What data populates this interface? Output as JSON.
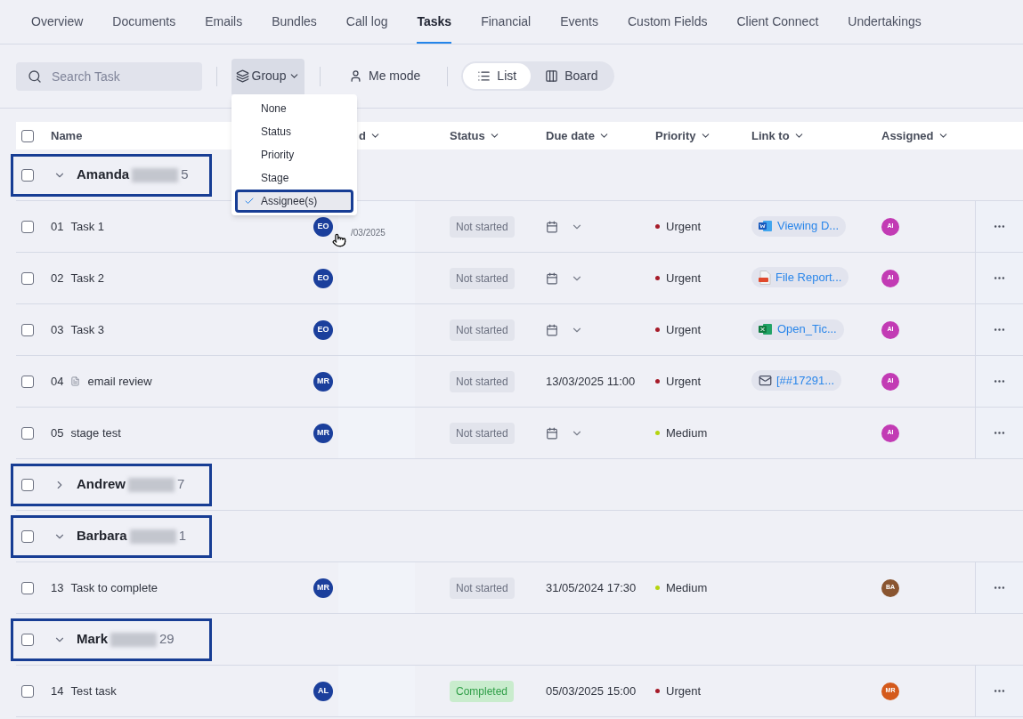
{
  "tabs": [
    {
      "label": "Overview",
      "selected": false
    },
    {
      "label": "Documents",
      "selected": false
    },
    {
      "label": "Emails",
      "selected": false
    },
    {
      "label": "Bundles",
      "selected": false
    },
    {
      "label": "Call log",
      "selected": false
    },
    {
      "label": "Tasks",
      "selected": true
    },
    {
      "label": "Financial",
      "selected": false
    },
    {
      "label": "Events",
      "selected": false
    },
    {
      "label": "Custom Fields",
      "selected": false
    },
    {
      "label": "Client Connect",
      "selected": false
    },
    {
      "label": "Undertakings",
      "selected": false
    }
  ],
  "toolbar": {
    "search": {
      "placeholder": "Search Task"
    },
    "group_button": "Group",
    "me_mode": "Me mode",
    "views": [
      {
        "label": "List",
        "kind": "list",
        "selected": true
      },
      {
        "label": "Board",
        "kind": "board",
        "selected": false
      }
    ]
  },
  "group_menu": [
    {
      "label": "None",
      "selected": false
    },
    {
      "label": "Status",
      "selected": false
    },
    {
      "label": "Priority",
      "selected": false
    },
    {
      "label": "Stage",
      "selected": false
    },
    {
      "label": "Assignee(s)",
      "selected": true
    }
  ],
  "select_all": {
    "checked": false
  },
  "columns": [
    {
      "label": "Name"
    },
    {
      "label": "d"
    },
    {
      "label": "Status"
    },
    {
      "label": "Due date"
    },
    {
      "label": "Priority"
    },
    {
      "label": "Link to"
    },
    {
      "label": "Assigned"
    }
  ],
  "groups": [
    {
      "name": "Amanda",
      "count": "5",
      "checked": false,
      "expanded": true,
      "highlighted": true,
      "tasks": [
        {
          "checked": false,
          "number": "01",
          "name": "Task 1",
          "creator": "EO",
          "created_date": "/03/2025",
          "status": {
            "label": "Not started",
            "kind": "open"
          },
          "priority": {
            "label": "Urgent",
            "color": "#a61b29"
          },
          "link": {
            "kind": "word",
            "text": "Viewing D..."
          },
          "assignee": {
            "initials": "AI",
            "color": "#c23bb4"
          }
        },
        {
          "checked": false,
          "number": "02",
          "name": "Task 2",
          "creator": "EO",
          "status": {
            "label": "Not started",
            "kind": "open"
          },
          "priority": {
            "label": "Urgent",
            "color": "#a61b29"
          },
          "link": {
            "kind": "pdf",
            "text": "File Report..."
          },
          "assignee": {
            "initials": "AI",
            "color": "#c23bb4"
          }
        },
        {
          "checked": false,
          "number": "03",
          "name": "Task 3",
          "creator": "EO",
          "status": {
            "label": "Not started",
            "kind": "open"
          },
          "priority": {
            "label": "Urgent",
            "color": "#a61b29"
          },
          "link": {
            "kind": "excel",
            "text": "Open_Tic..."
          },
          "assignee": {
            "initials": "AI",
            "color": "#c23bb4"
          }
        },
        {
          "checked": false,
          "number": "04",
          "name": "email review",
          "has_doc": true,
          "creator": "MR",
          "status": {
            "label": "Not started",
            "kind": "open"
          },
          "due": "13/03/2025 11:00",
          "priority": {
            "label": "Urgent",
            "color": "#a61b29"
          },
          "link": {
            "kind": "email",
            "text": "[##17291..."
          },
          "assignee": {
            "initials": "AI",
            "color": "#c23bb4"
          }
        },
        {
          "checked": false,
          "number": "05",
          "name": "stage test",
          "creator": "MR",
          "status": {
            "label": "Not started",
            "kind": "open"
          },
          "priority": {
            "label": "Medium",
            "color": "#b5d40f"
          },
          "assignee": {
            "initials": "AI",
            "color": "#c23bb4"
          }
        }
      ]
    },
    {
      "name": "Andrew",
      "count": "7",
      "checked": false,
      "expanded": false,
      "highlighted": true
    },
    {
      "name": "Barbara",
      "count": "1",
      "checked": false,
      "expanded": true,
      "highlighted": true,
      "tasks": [
        {
          "checked": false,
          "number": "13",
          "name": "Task to complete",
          "creator": "MR",
          "status": {
            "label": "Not started",
            "kind": "open"
          },
          "due": "31/05/2024 17:30",
          "priority": {
            "label": "Medium",
            "color": "#b5d40f"
          },
          "assignee": {
            "initials": "BA",
            "color": "#8a5530"
          }
        }
      ]
    },
    {
      "name": "Mark",
      "count": "29",
      "checked": false,
      "expanded": true,
      "highlighted": true,
      "tasks": [
        {
          "checked": false,
          "number": "14",
          "name": "Test task",
          "creator": "AL",
          "status": {
            "label": "Completed",
            "kind": "done"
          },
          "due": "05/03/2025 15:00",
          "priority": {
            "label": "Urgent",
            "color": "#a61b29"
          },
          "assignee": {
            "initials": "MR",
            "color": "#d45a1c"
          }
        }
      ]
    }
  ]
}
